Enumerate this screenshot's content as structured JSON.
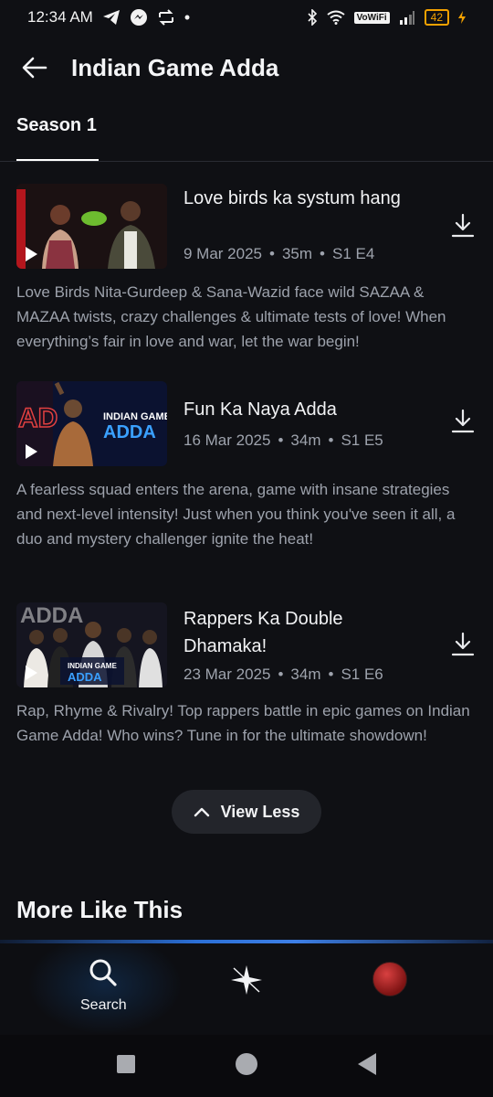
{
  "status_bar": {
    "time": "12:34 AM",
    "vowifi": "VoWiFi",
    "battery": "42",
    "icons": [
      "telegram-icon",
      "messenger-icon",
      "sync-icon",
      "bluetooth-icon",
      "wifi-icon",
      "signal-icon",
      "charging-icon"
    ]
  },
  "header": {
    "title": "Indian Game Adda"
  },
  "tabs": [
    {
      "label": "Season 1",
      "selected": true
    }
  ],
  "episodes": [
    {
      "title": "Love birds ka systum hang",
      "date": "9 Mar 2025",
      "duration": "35m",
      "code": "S1 E4",
      "description": "Love Birds Nita-Gurdeep & Sana-Wazid face wild SAZAA & MAZAA twists, crazy challenges & ultimate tests of love! When everything’s fair in love and war, let the war begin!"
    },
    {
      "title": "Fun Ka Naya Adda",
      "date": "16 Mar 2025",
      "duration": "34m",
      "code": "S1 E5",
      "description": "A fearless squad enters the arena, game with insane strategies and next-level intensity! Just when you think you've seen it all, a duo and mystery challenger ignite the heat!"
    },
    {
      "title": "Rappers Ka Double Dhamaka!",
      "date": "23 Mar 2025",
      "duration": "34m",
      "code": "S1 E6",
      "description": "Rap, Rhyme & Rivalry! Top rappers battle in epic games on Indian Game Adda! Who wins? Tune in for the ultimate showdown!"
    }
  ],
  "thumbnail_text": {
    "brand_line1": "INDIAN GAME",
    "brand_line2": "ADDA"
  },
  "view_less": {
    "label": "View Less"
  },
  "more_like_this": {
    "title": "More Like This"
  },
  "bottom_nav": {
    "search_label": "Search",
    "accent": "#2b6fd6"
  }
}
